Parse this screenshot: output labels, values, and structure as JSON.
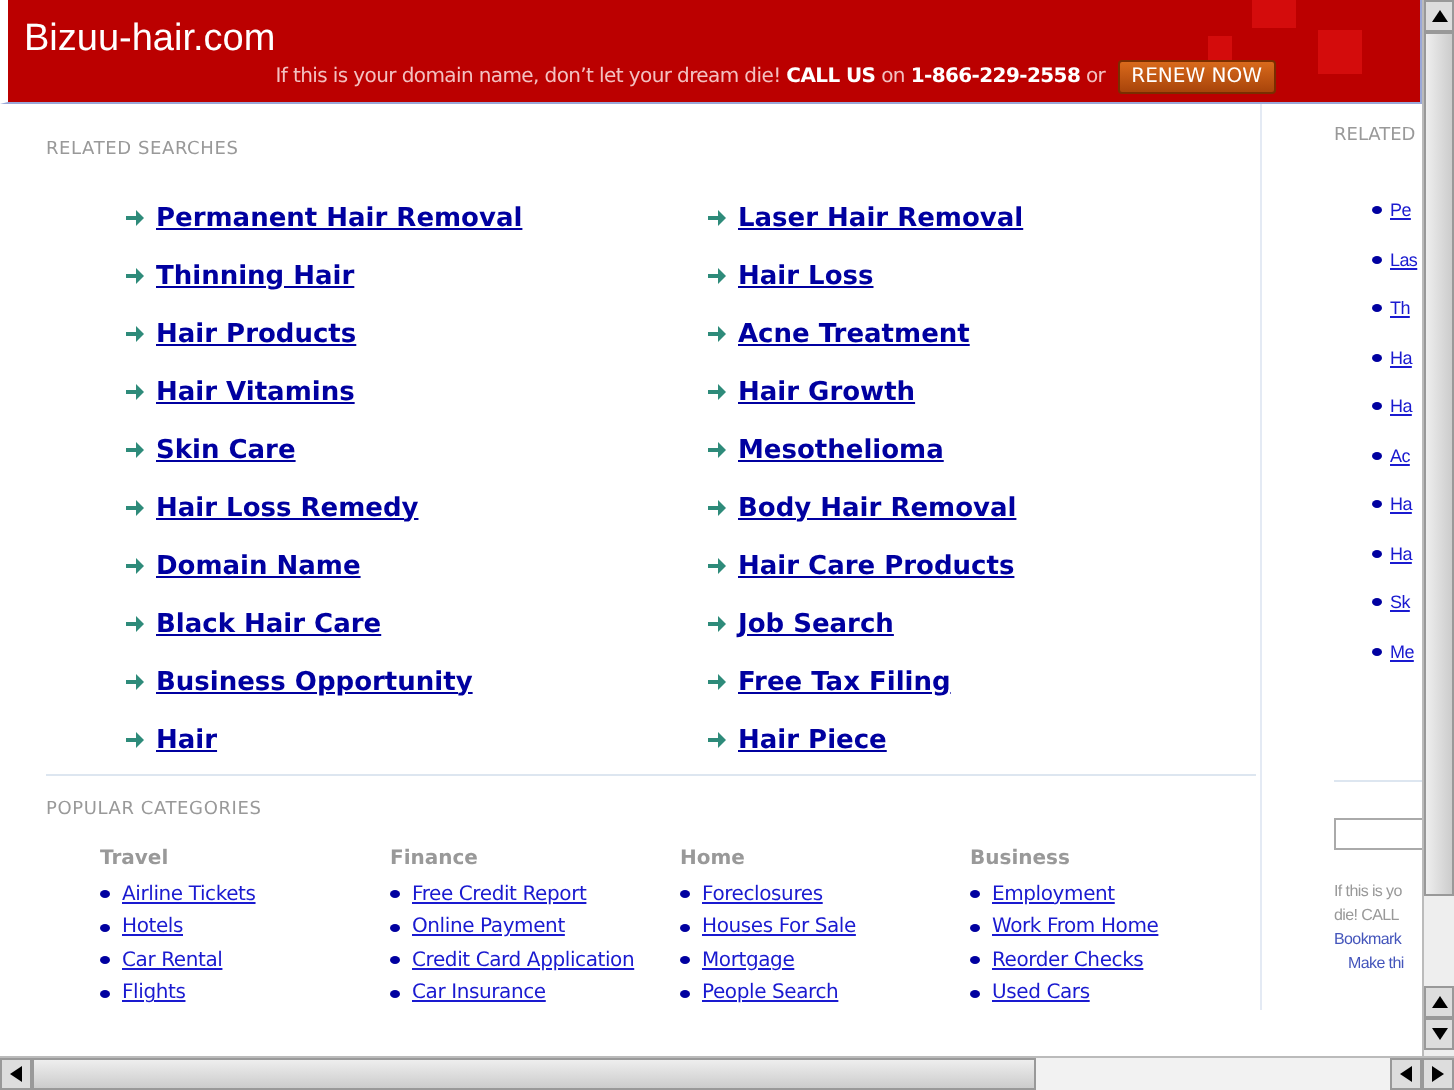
{
  "header": {
    "site_title": "Bizuu-hair.com",
    "message_lead": "If this is your domain name, don’t let your dream die!",
    "call_us": "CALL US",
    "on": "on",
    "phone": "1-866-229-2558",
    "or": "or",
    "renew_button": "RENEW NOW"
  },
  "related_searches": {
    "heading": "RELATED SEARCHES",
    "links": [
      {
        "label": "Permanent Hair Removal"
      },
      {
        "label": "Laser Hair Removal"
      },
      {
        "label": "Thinning Hair"
      },
      {
        "label": "Hair Loss"
      },
      {
        "label": "Hair Products"
      },
      {
        "label": "Acne Treatment"
      },
      {
        "label": "Hair Vitamins"
      },
      {
        "label": "Hair Growth"
      },
      {
        "label": "Skin Care"
      },
      {
        "label": "Mesothelioma"
      },
      {
        "label": "Hair Loss Remedy"
      },
      {
        "label": "Body Hair Removal"
      },
      {
        "label": "Domain Name"
      },
      {
        "label": "Hair Care Products"
      },
      {
        "label": "Black Hair Care"
      },
      {
        "label": "Job Search"
      },
      {
        "label": "Business Opportunity"
      },
      {
        "label": "Free Tax Filing"
      },
      {
        "label": "Hair"
      },
      {
        "label": "Hair Piece"
      }
    ]
  },
  "popular_categories": {
    "heading": "POPULAR CATEGORIES",
    "columns": [
      {
        "title": "Travel",
        "links": [
          "Airline Tickets",
          "Hotels",
          "Car Rental",
          "Flights"
        ]
      },
      {
        "title": "Finance",
        "links": [
          "Free Credit Report",
          "Online Payment",
          "Credit Card Application",
          "Car Insurance"
        ]
      },
      {
        "title": "Home",
        "links": [
          "Foreclosures",
          "Houses For Sale",
          "Mortgage",
          "People Search"
        ]
      },
      {
        "title": "Business",
        "links": [
          "Employment",
          "Work From Home",
          "Reorder Checks",
          "Used Cars"
        ]
      }
    ]
  },
  "side_panel": {
    "heading": "RELATED",
    "links": [
      "Pe",
      "Las",
      "Th",
      "Ha",
      "Ha",
      "Ac",
      "Ha",
      "Ha",
      "Sk",
      "Me"
    ],
    "note_lines": [
      "If this is yo",
      "die! CALL"
    ],
    "bookmark": "Bookmark",
    "make_this": "Make thi"
  }
}
